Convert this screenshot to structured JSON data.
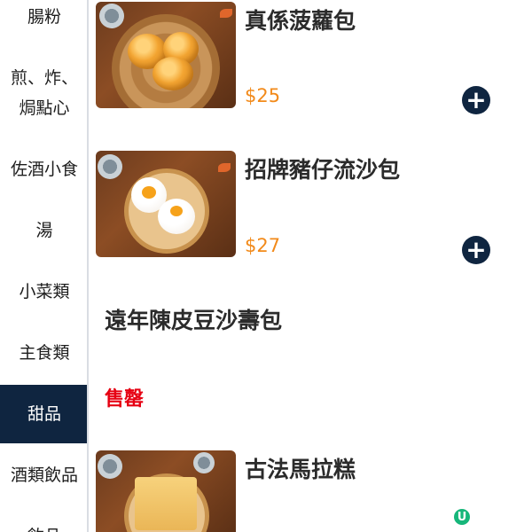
{
  "sidebar": {
    "items": [
      {
        "label": "腸粉",
        "active": false
      },
      {
        "label": "煎、炸、\n焗點心",
        "active": false
      },
      {
        "label": "佐酒小食",
        "active": false
      },
      {
        "label": "湯",
        "active": false
      },
      {
        "label": "小菜類",
        "active": false
      },
      {
        "label": "主食類",
        "active": false
      },
      {
        "label": "甜品",
        "active": true
      },
      {
        "label": "酒類飲品",
        "active": false
      },
      {
        "label": "飲品",
        "active": false
      }
    ]
  },
  "menu": {
    "items": [
      {
        "name": "真係菠蘿包",
        "price": "$25",
        "has_image": true,
        "sold_out": false
      },
      {
        "name": "招牌豬仔流沙包",
        "price": "$27",
        "has_image": true,
        "sold_out": false
      },
      {
        "name": "遠年陳皮豆沙壽包",
        "status": "售罄",
        "has_image": false,
        "sold_out": true
      },
      {
        "name": "古法馬拉糕",
        "has_image": true,
        "sold_out": false
      }
    ]
  },
  "colors": {
    "accent_navy": "#0f2540",
    "price_orange": "#f28a1a",
    "sold_out_red": "#e60012"
  },
  "icons": {
    "add": "plus-circle-icon",
    "floating": "u-badge-icon"
  },
  "fab": {
    "label": "U"
  }
}
